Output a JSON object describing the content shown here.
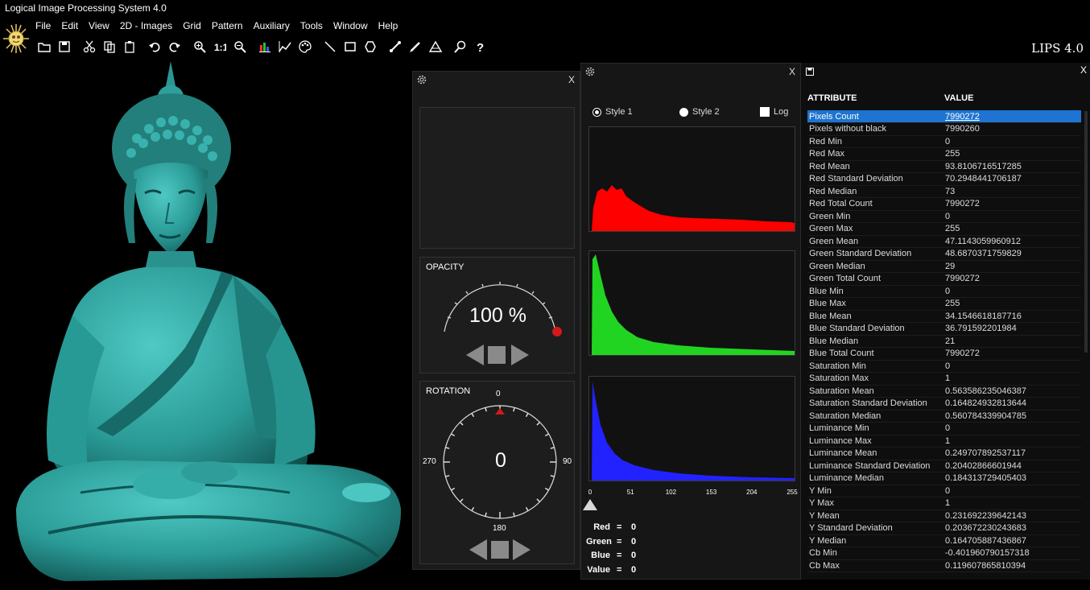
{
  "window": {
    "title": "Logical Image Processing System 4.0",
    "brand": "LIPS 4.0"
  },
  "menu": [
    "File",
    "Edit",
    "View",
    "2D - Images",
    "Grid",
    "Pattern",
    "Auxiliary",
    "Tools",
    "Window",
    "Help"
  ],
  "toolbar": [
    "open-folder-icon",
    "save-icon",
    "|",
    "cut-icon",
    "copy-icon",
    "paste-icon",
    "|",
    "undo-icon",
    "redo-icon",
    "|",
    "zoom-in-icon",
    "actual-size-icon",
    "zoom-out-icon",
    "|",
    "histogram-icon",
    "line-chart-icon",
    "palette-icon",
    "|",
    "line-tool-icon",
    "rectangle-tool-icon",
    "hexagon-tool-icon",
    "|",
    "measure-icon",
    "pen-icon",
    "triangle-icon",
    "|",
    "search-icon",
    "help-icon"
  ],
  "controls": {
    "close": "X",
    "opacity": {
      "label": "OPACITY",
      "value": "100 %",
      "level": 1.0
    },
    "rotation": {
      "label": "ROTATION",
      "value": "0",
      "ticks": {
        "top": "0",
        "right": "90",
        "bottom": "180",
        "left": "270"
      }
    }
  },
  "histogram": {
    "close": "X",
    "style1": "Style 1",
    "style2": "Style 2",
    "log": "Log",
    "colors": {
      "red": "#ff0000",
      "green": "#22d422",
      "blue": "#2222ff"
    },
    "axis": [
      "0",
      "51",
      "102",
      "153",
      "204",
      "255"
    ],
    "values": [
      {
        "label": "Red",
        "eq": "=",
        "value": "0"
      },
      {
        "label": "Green",
        "eq": "=",
        "value": "0"
      },
      {
        "label": "Blue",
        "eq": "=",
        "value": "0"
      },
      {
        "label": "Value",
        "eq": "=",
        "value": "0"
      }
    ]
  },
  "stats": {
    "close": "X",
    "col_attribute": "ATTRIBUTE",
    "col_value": "VALUE",
    "rows": [
      [
        "Pixels Count",
        "7990272"
      ],
      [
        "Pixels without black",
        "7990260"
      ],
      [
        "Red Min",
        "0"
      ],
      [
        "Red Max",
        "255"
      ],
      [
        "Red Mean",
        "93.8106716517285"
      ],
      [
        "Red Standard Deviation",
        "70.2948441706187"
      ],
      [
        "Red Median",
        "73"
      ],
      [
        "Red Total Count",
        "7990272"
      ],
      [
        "Green Min",
        "0"
      ],
      [
        "Green Max",
        "255"
      ],
      [
        "Green Mean",
        "47.1143059960912"
      ],
      [
        "Green Standard Deviation",
        "48.6870371759829"
      ],
      [
        "Green Median",
        "29"
      ],
      [
        "Green Total Count",
        "7990272"
      ],
      [
        "Blue Min",
        "0"
      ],
      [
        "Blue Max",
        "255"
      ],
      [
        "Blue Mean",
        "34.1546618187716"
      ],
      [
        "Blue Standard Deviation",
        "36.791592201984"
      ],
      [
        "Blue Median",
        "21"
      ],
      [
        "Blue Total Count",
        "7990272"
      ],
      [
        "Saturation Min",
        "0"
      ],
      [
        "Saturation Max",
        "1"
      ],
      [
        "Saturation Mean",
        "0.563586235046387"
      ],
      [
        "Saturation Standard Deviation",
        "0.164824932813644"
      ],
      [
        "Saturation Median",
        "0.560784339904785"
      ],
      [
        "Luminance Min",
        "0"
      ],
      [
        "Luminance Max",
        "1"
      ],
      [
        "Luminance Mean",
        "0.249707892537117"
      ],
      [
        "Luminance Standard Deviation",
        "0.20402866601944"
      ],
      [
        "Luminance Median",
        "0.184313729405403"
      ],
      [
        "Y Min",
        "0"
      ],
      [
        "Y Max",
        "1"
      ],
      [
        "Y Mean",
        "0.231692239642143"
      ],
      [
        "Y Standard Deviation",
        "0.203672230243683"
      ],
      [
        "Y Median",
        "0.164705887436867"
      ],
      [
        "Cb Min",
        "-0.401960790157318"
      ],
      [
        "Cb Max",
        "0.119607865810394"
      ]
    ]
  }
}
